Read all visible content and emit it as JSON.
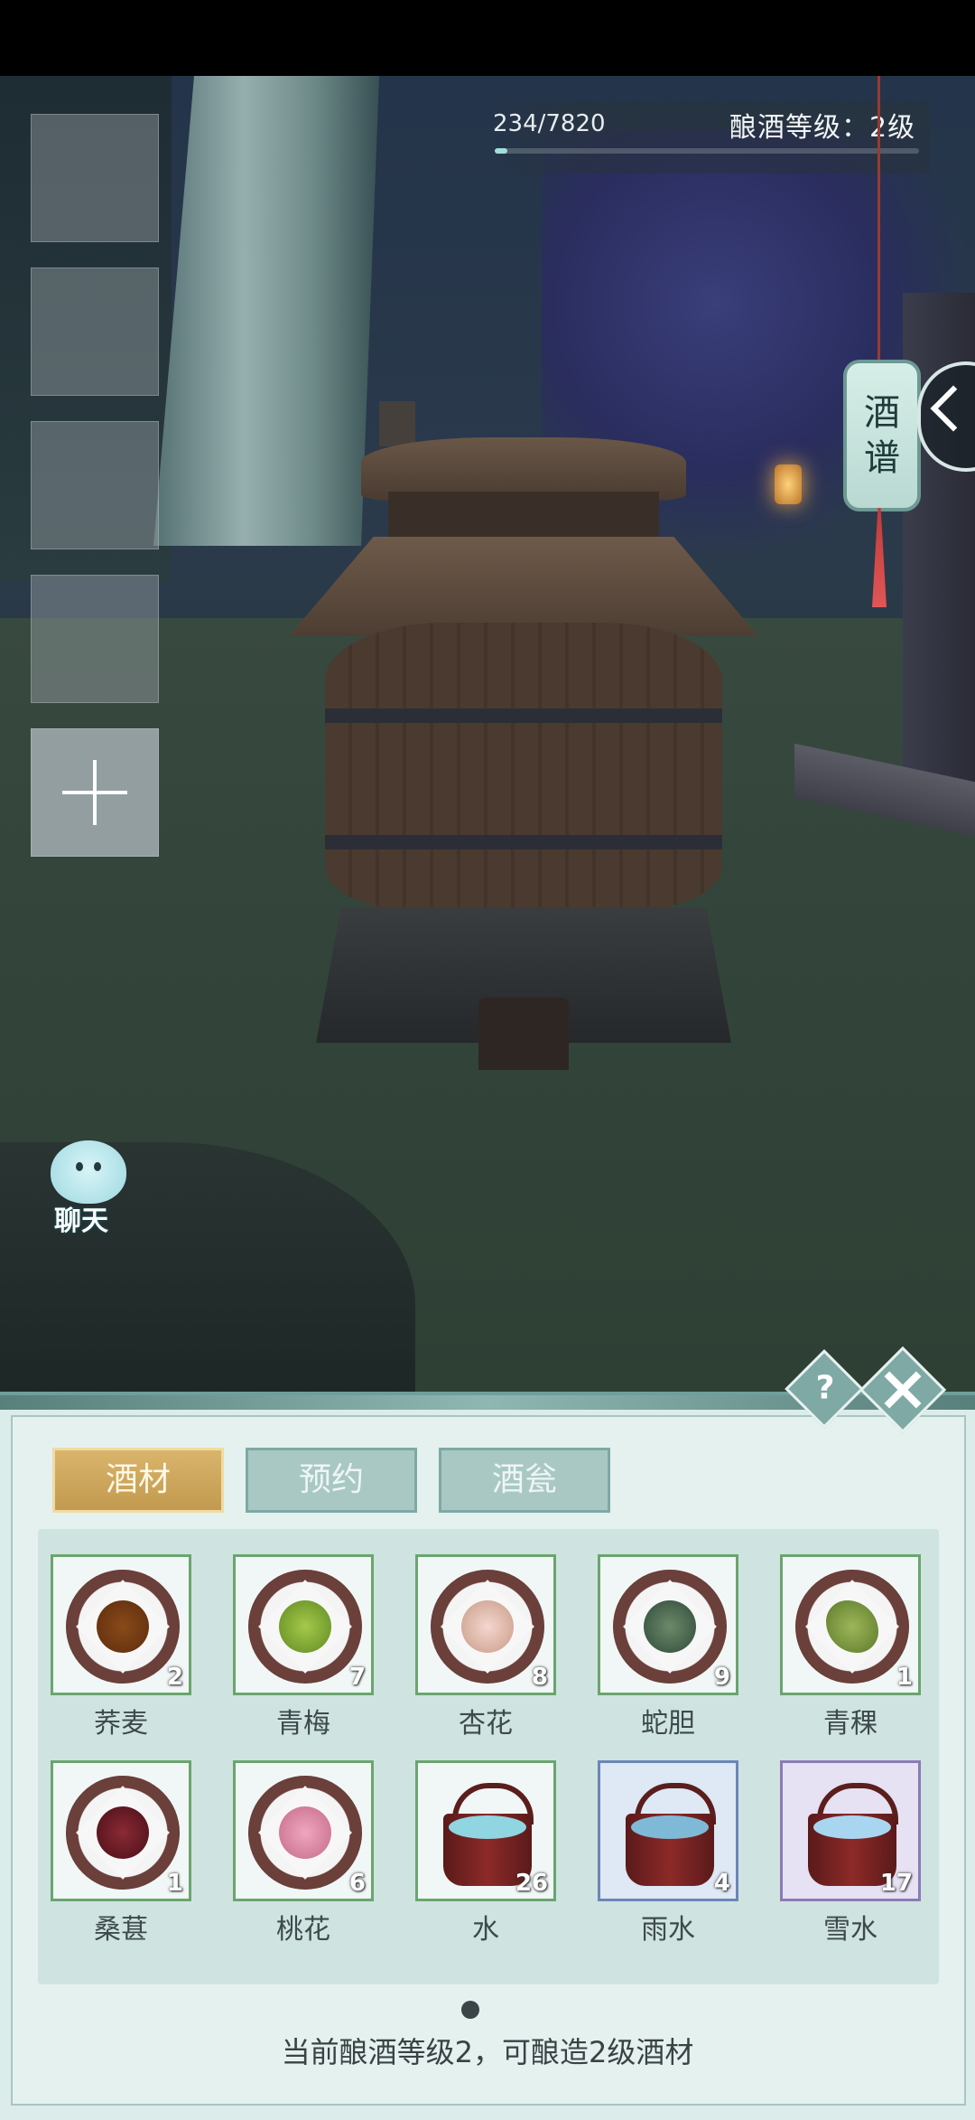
{
  "header": {
    "exp_text": "234/7820",
    "exp_current": 234,
    "exp_max": 7820,
    "level_text": "酿酒等级：2级"
  },
  "side": {
    "recipe_tag_chars": [
      "酒",
      "谱"
    ]
  },
  "chat": {
    "label": "聊天"
  },
  "panel": {
    "tabs": [
      {
        "label": "酒材",
        "active": true
      },
      {
        "label": "预约",
        "active": false
      },
      {
        "label": "酒瓮",
        "active": false
      }
    ],
    "items": [
      {
        "name": "荞麦",
        "count": "2"
      },
      {
        "name": "青梅",
        "count": "7"
      },
      {
        "name": "杏花",
        "count": "8"
      },
      {
        "name": "蛇胆",
        "count": "9"
      },
      {
        "name": "青稞",
        "count": "1"
      },
      {
        "name": "桑葚",
        "count": "1"
      },
      {
        "name": "桃花",
        "count": "6"
      },
      {
        "name": "水",
        "count": "26"
      },
      {
        "name": "雨水",
        "count": "4"
      },
      {
        "name": "雪水",
        "count": "17"
      }
    ],
    "footer_text": "当前酿酒等级2，可酿造2级酒材"
  },
  "colors": {
    "active_tab": "#c9a257",
    "green_border": "#6aa56f",
    "blue_border": "#6b86b8",
    "purple_border": "#8b7bb6"
  },
  "icons": [
    "plus-icon",
    "question-icon",
    "close-icon",
    "chevron-left-icon"
  ]
}
